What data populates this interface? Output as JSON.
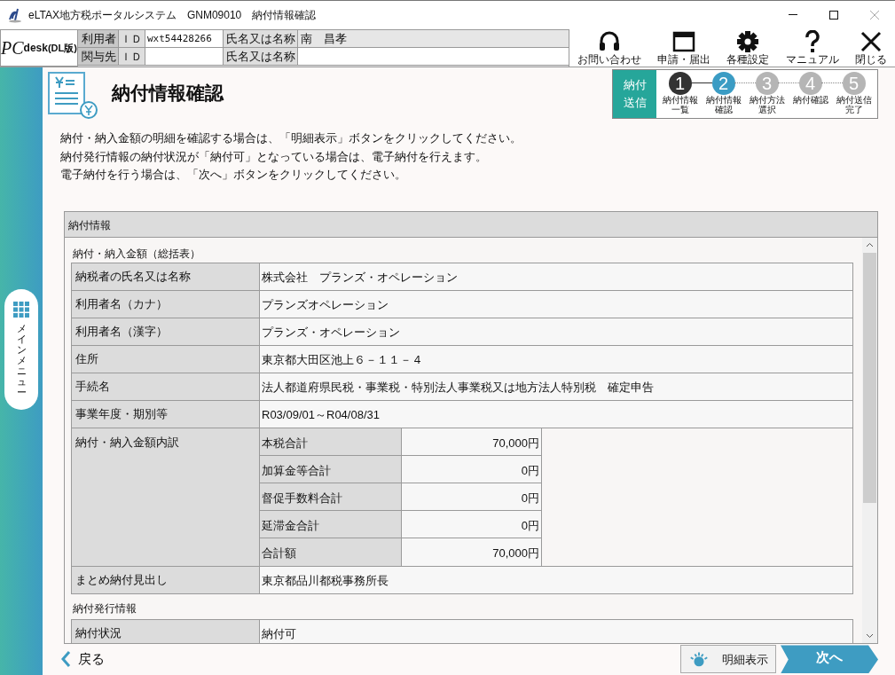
{
  "window": {
    "title": "eLTAX地方税ポータルシステム　GNM09010　納付情報確認"
  },
  "header": {
    "logo_main": "PC",
    "logo_sub": "desk",
    "logo_edition": "(DL版)",
    "user_rows": [
      {
        "role": "利用者",
        "id_label": "ＩＤ",
        "id": "wxt54428266",
        "name_label": "氏名又は名称",
        "name": "南　昌孝"
      },
      {
        "role": "関与先",
        "id_label": "ＩＤ",
        "name_label": "氏名又は名称"
      }
    ],
    "tools": [
      {
        "kind": "headset",
        "label": "お問い合わせ"
      },
      {
        "kind": "window",
        "label": "申請・届出"
      },
      {
        "kind": "gear",
        "label": "各種設定"
      },
      {
        "kind": "help",
        "label": "マニュアル"
      },
      {
        "kind": "close",
        "label": "閉じる"
      }
    ]
  },
  "sidebar": {
    "menu_label": "メインメニュー"
  },
  "page": {
    "title": "納付情報確認",
    "flow_label": "納付送信",
    "steps": [
      {
        "number": "1",
        "label": "納付情報一覧",
        "done": true,
        "current": false
      },
      {
        "number": "2",
        "label": "納付情報確認",
        "done": false,
        "current": true
      },
      {
        "number": "3",
        "label": "納付方法選択",
        "done": false,
        "current": false
      },
      {
        "number": "4",
        "label": "納付確認",
        "done": false,
        "current": false
      },
      {
        "number": "5",
        "label": "納付送信完了",
        "done": false,
        "current": false
      }
    ],
    "instructions": [
      "納付・納入金額の明細を確認する場合は、「明細表示」ボタンをクリックしてください。",
      "納付発行情報の納付状況が「納付可」となっている場合は、電子納付を行えます。",
      "電子納付を行う場合は、「次へ」ボタンをクリックしてください。"
    ]
  },
  "panel": {
    "title": "納付情報",
    "section_1": "納付・納入金額（総括表）",
    "rows_1": [
      {
        "label": "納税者の氏名又は名称",
        "value": "株式会社　プランズ・オペレーション"
      },
      {
        "label": "利用者名（カナ）",
        "value": "プランズオペレーション"
      },
      {
        "label": "利用者名（漢字）",
        "value": "プランズ・オペレーション"
      },
      {
        "label": "住所",
        "value": "東京都大田区池上６－１１－４"
      },
      {
        "label": "手続名",
        "value": "法人都道府県民税・事業税・特別法人事業税又は地方法人特別税　確定申告"
      },
      {
        "label": "事業年度・期別等",
        "value": "R03/09/01～R04/08/31"
      }
    ],
    "breakdown": {
      "label": "納付・納入金額内訳",
      "items": [
        {
          "label": "本税合計",
          "amount": "70,000円"
        },
        {
          "label": "加算金等合計",
          "amount": "0円"
        },
        {
          "label": "督促手数料合計",
          "amount": "0円"
        },
        {
          "label": "延滞金合計",
          "amount": "0円"
        },
        {
          "label": "合計額",
          "amount": "70,000円"
        }
      ]
    },
    "rows_2": [
      {
        "label": "まとめ納付見出し",
        "value": "東京都品川都税事務所長"
      }
    ],
    "section_2": "納付発行情報",
    "rows_3": [
      {
        "label": "納付状況",
        "value": "納付可"
      }
    ]
  },
  "footer": {
    "back": "戻る",
    "detail": "明細表示",
    "next": "次へ"
  }
}
